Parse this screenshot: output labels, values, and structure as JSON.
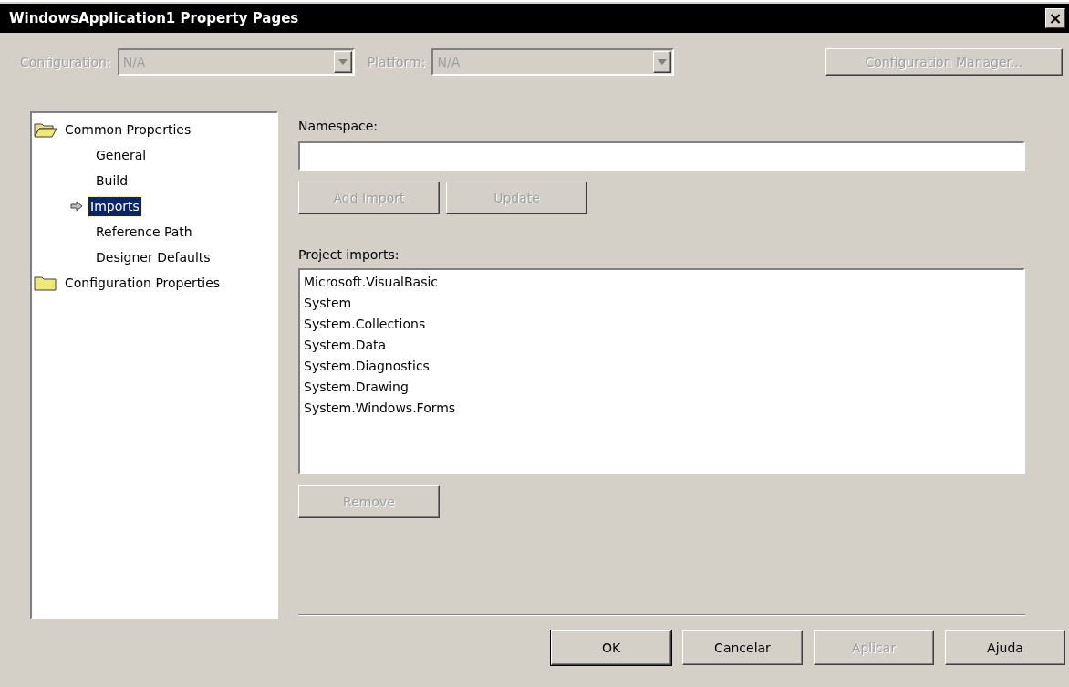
{
  "window": {
    "title": "WindowsApplication1 Property Pages",
    "close": "×"
  },
  "configuration": {
    "label": "Configuration:",
    "value": "N/A",
    "disabled": true
  },
  "platform": {
    "label": "Platform:",
    "value": "N/A",
    "disabled": true
  },
  "config_manager_button": {
    "label": "Configuration Manager...",
    "disabled": true
  },
  "tree": [
    {
      "label": "Common Properties",
      "expanded": true,
      "selected": false,
      "children": [
        {
          "label": "General",
          "selected": false
        },
        {
          "label": "Build",
          "selected": false
        },
        {
          "label": "Imports",
          "selected": true
        },
        {
          "label": "Reference Path",
          "selected": false
        },
        {
          "label": "Designer Defaults",
          "selected": false
        }
      ]
    },
    {
      "label": "Configuration Properties",
      "expanded": false,
      "selected": false
    }
  ],
  "namespace": {
    "label": "Namespace:"
  },
  "namespace_buttons": [
    {
      "label": "Add Import",
      "disabled": true
    },
    {
      "label": "Update",
      "disabled": true
    }
  ],
  "project_imports": {
    "label": "Project imports:",
    "items": [
      "Microsoft.VisualBasic",
      "System",
      "System.Collections",
      "System.Data",
      "System.Diagnostics",
      "System.Drawing",
      "System.Windows.Forms"
    ]
  },
  "remove_button": {
    "label": "Remove",
    "disabled": true
  },
  "buttons": [
    {
      "label": "OK",
      "default": true,
      "disabled": false
    },
    {
      "label": "Cancelar",
      "default": false,
      "disabled": false
    },
    {
      "label": "Aplicar",
      "default": false,
      "disabled": true
    },
    {
      "label": "Ajuda",
      "default": false,
      "disabled": false
    }
  ]
}
